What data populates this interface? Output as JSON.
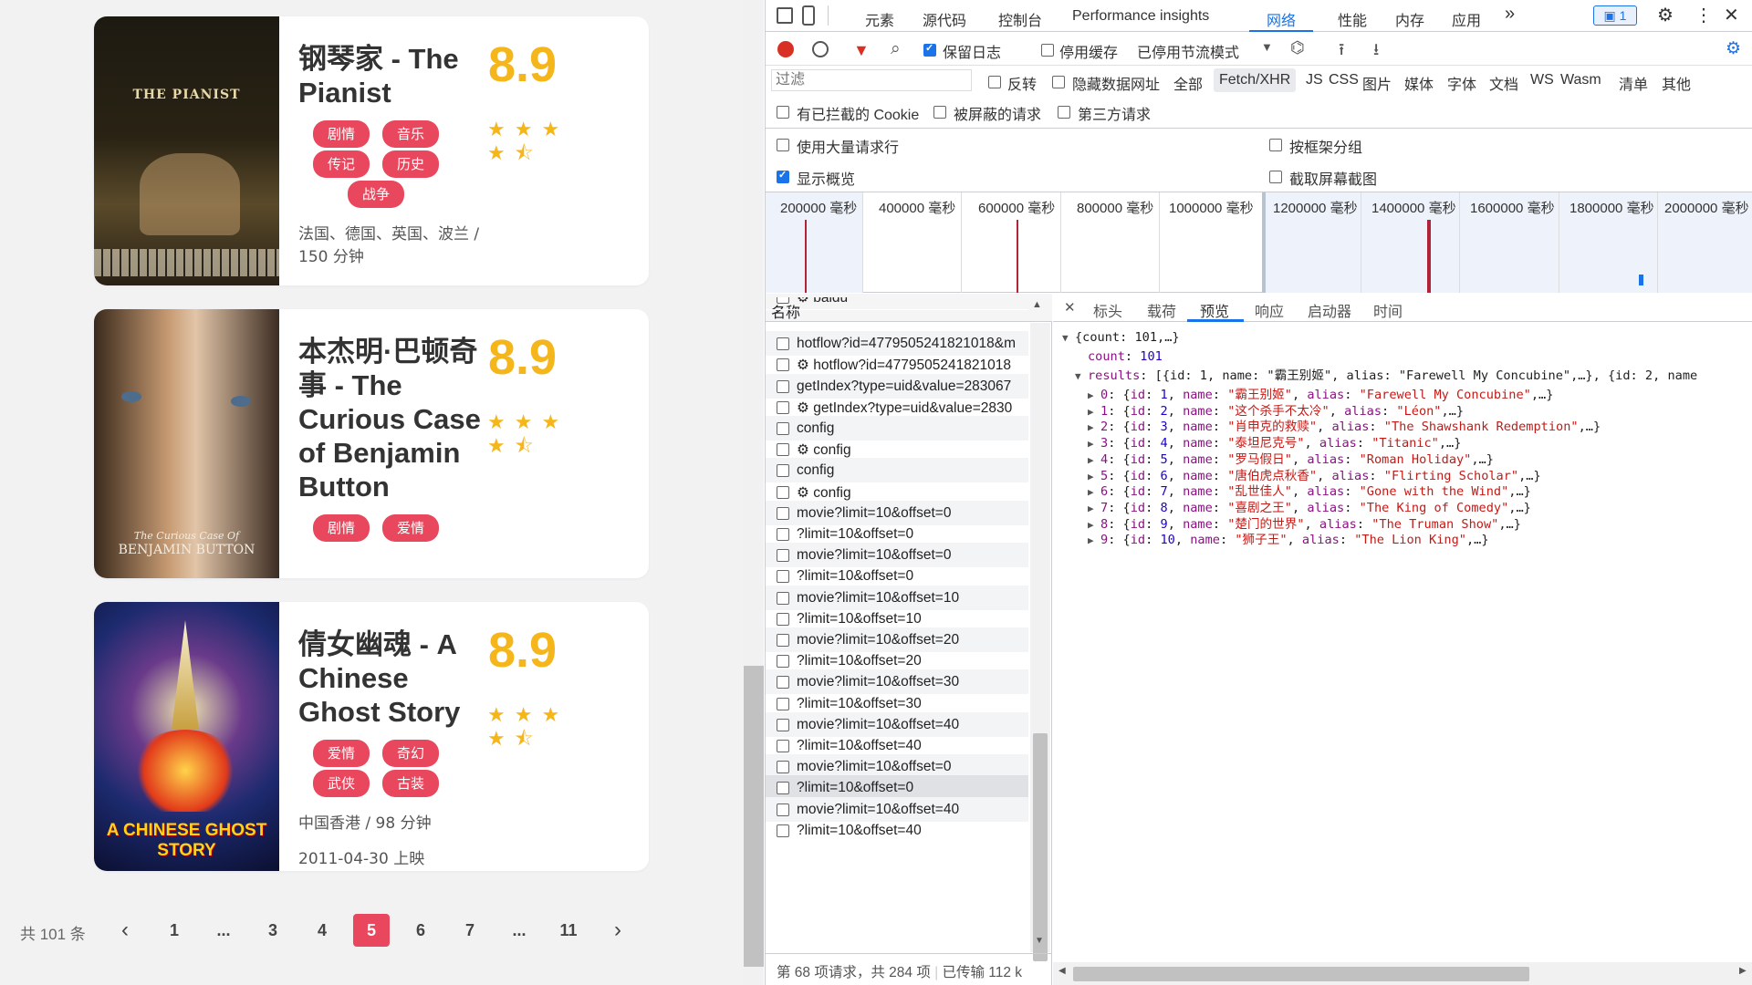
{
  "movies": [
    {
      "title": "钢琴家 - The Pianist",
      "score": "8.9",
      "tags": [
        "剧情",
        "音乐",
        "传记",
        "历史",
        "战争"
      ],
      "meta1": "法国、德国、英国、波兰 / 150 分钟",
      "poster_text": "THE PIANIST"
    },
    {
      "title": "本杰明·巴顿奇事 - The Curious Case of Benjamin Button",
      "score": "8.9",
      "tags": [
        "剧情",
        "爱情"
      ],
      "poster_text": "BENJAMIN BUTTON",
      "poster_subtext": "The Curious Case Of"
    },
    {
      "title": "倩女幽魂 - A Chinese Ghost Story",
      "score": "8.9",
      "tags": [
        "爱情",
        "奇幻",
        "武侠",
        "古装"
      ],
      "meta1": "中国香港 / 98 分钟",
      "meta2": "2011-04-30 上映",
      "poster_text": "A CHINESE GHOST STORY"
    }
  ],
  "rating": {
    "stars": 5,
    "filled": 4.5
  },
  "pagination": {
    "total": "共 101 条",
    "prev": "‹",
    "next": "›",
    "pages": [
      "1",
      "...",
      "3",
      "4",
      "5",
      "6",
      "7",
      "...",
      "11"
    ],
    "active": "5"
  },
  "devtools": {
    "tabs": [
      "元素",
      "源代码",
      "控制台",
      "Performance insights",
      "网络",
      "性能",
      "内存",
      "应用"
    ],
    "active_tab": "网络",
    "more": "»",
    "badge": "1",
    "toolbar": {
      "preserve_log": "保留日志",
      "disable_cache": "停用缓存",
      "throttle": "已停用节流模式"
    },
    "filter": {
      "placeholder": "过滤",
      "invert": "反转",
      "hide_data_urls": "隐藏数据网址",
      "types": [
        "全部",
        "Fetch/XHR",
        "JS",
        "CSS",
        "图片",
        "媒体",
        "字体",
        "文档",
        "WS",
        "Wasm",
        "清单",
        "其他"
      ],
      "active_type": "Fetch/XHR",
      "blocked_cookies": "有已拦截的 Cookie",
      "blocked_requests": "被屏蔽的请求",
      "third_party": "第三方请求"
    },
    "options": {
      "big_rows": "使用大量请求行",
      "group_by_frame": "按框架分组",
      "show_overview": "显示概览",
      "capture_screenshots": "截取屏幕截图"
    },
    "timeline_ticks": [
      "200000 毫秒",
      "400000 毫秒",
      "600000 毫秒",
      "800000 毫秒",
      "1000000 毫秒",
      "1200000 毫秒",
      "1400000 毫秒",
      "1600000 毫秒",
      "1800000 毫秒",
      "2000000 毫秒"
    ],
    "name_header": "名称",
    "requests": [
      {
        "name": "baidu",
        "gear": true
      },
      {
        "name": "hotflow?id=4779505241821018&m",
        "gear": false
      },
      {
        "name": "hotflow?id=4779505241821018",
        "gear": true
      },
      {
        "name": "getIndex?type=uid&value=283067",
        "gear": false
      },
      {
        "name": "getIndex?type=uid&value=2830",
        "gear": true
      },
      {
        "name": "config",
        "gear": false
      },
      {
        "name": "config",
        "gear": true
      },
      {
        "name": "config",
        "gear": false
      },
      {
        "name": "config",
        "gear": true
      },
      {
        "name": "movie?limit=10&offset=0",
        "gear": false
      },
      {
        "name": "?limit=10&offset=0",
        "gear": false
      },
      {
        "name": "movie?limit=10&offset=0",
        "gear": false
      },
      {
        "name": "?limit=10&offset=0",
        "gear": false
      },
      {
        "name": "movie?limit=10&offset=10",
        "gear": false
      },
      {
        "name": "?limit=10&offset=10",
        "gear": false
      },
      {
        "name": "movie?limit=10&offset=20",
        "gear": false
      },
      {
        "name": "?limit=10&offset=20",
        "gear": false
      },
      {
        "name": "movie?limit=10&offset=30",
        "gear": false
      },
      {
        "name": "?limit=10&offset=30",
        "gear": false
      },
      {
        "name": "movie?limit=10&offset=40",
        "gear": false
      },
      {
        "name": "?limit=10&offset=40",
        "gear": false
      },
      {
        "name": "movie?limit=10&offset=0",
        "gear": false
      },
      {
        "name": "?limit=10&offset=0",
        "gear": false,
        "selected": true
      },
      {
        "name": "movie?limit=10&offset=40",
        "gear": false
      },
      {
        "name": "?limit=10&offset=40",
        "gear": false
      }
    ],
    "status": "第 68 项请求，共 284 项",
    "transferred": "已传输 112 k",
    "detail_tabs": [
      "标头",
      "载荷",
      "预览",
      "响应",
      "启动器",
      "时间"
    ],
    "active_detail_tab": "预览",
    "preview": {
      "root": "{count: 101,…}",
      "count_key": "count",
      "count_val": "101",
      "results_key": "results",
      "results_summary": "[{id: 1, name: \"霸王别姬\", alias: \"Farewell My Concubine\",…}, {id: 2, name",
      "items": [
        {
          "idx": "0",
          "id": "1",
          "name": "\"霸王别姬\"",
          "alias": "\"Farewell My Concubine\""
        },
        {
          "idx": "1",
          "id": "2",
          "name": "\"这个杀手不太冷\"",
          "alias": "\"Léon\""
        },
        {
          "idx": "2",
          "id": "3",
          "name": "\"肖申克的救赎\"",
          "alias": "\"The Shawshank Redemption\""
        },
        {
          "idx": "3",
          "id": "4",
          "name": "\"泰坦尼克号\"",
          "alias": "\"Titanic\""
        },
        {
          "idx": "4",
          "id": "5",
          "name": "\"罗马假日\"",
          "alias": "\"Roman Holiday\""
        },
        {
          "idx": "5",
          "id": "6",
          "name": "\"唐伯虎点秋香\"",
          "alias": "\"Flirting Scholar\""
        },
        {
          "idx": "6",
          "id": "7",
          "name": "\"乱世佳人\"",
          "alias": "\"Gone with the Wind\""
        },
        {
          "idx": "7",
          "id": "8",
          "name": "\"喜剧之王\"",
          "alias": "\"The King of Comedy\""
        },
        {
          "idx": "8",
          "id": "9",
          "name": "\"楚门的世界\"",
          "alias": "\"The Truman Show\""
        },
        {
          "idx": "9",
          "id": "10",
          "name": "\"狮子王\"",
          "alias": "\"The Lion King\""
        }
      ]
    }
  },
  "colors": {
    "accent": "#e8475d",
    "score": "#f5b61c",
    "devtools_blue": "#1a73e8",
    "record_red": "#d93025"
  }
}
